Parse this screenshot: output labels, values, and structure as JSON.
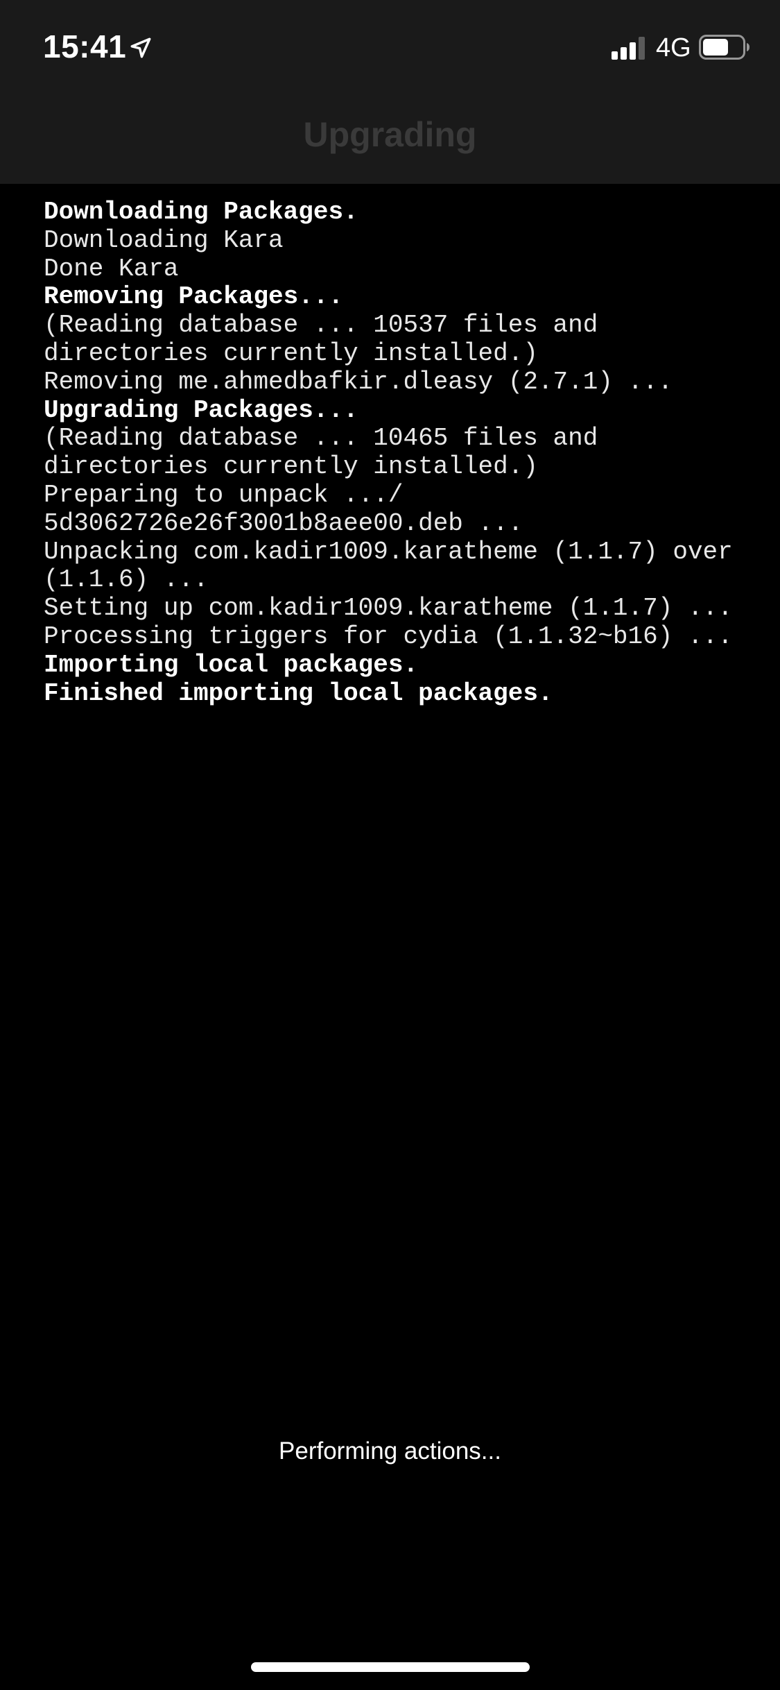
{
  "status_bar": {
    "time": "15:41",
    "network": "4G",
    "icons": [
      "location-arrow-icon",
      "cellular-signal-icon",
      "battery-icon"
    ]
  },
  "nav": {
    "title": "Upgrading"
  },
  "console": {
    "lines": [
      {
        "text": "Downloading Packages.",
        "bold": true
      },
      {
        "text": "Downloading Kara",
        "bold": false
      },
      {
        "text": "Done Kara",
        "bold": false
      },
      {
        "text": "Removing Packages...",
        "bold": true
      },
      {
        "text": "(Reading database ... 10537 files and",
        "bold": false
      },
      {
        "text": "directories currently installed.)",
        "bold": false
      },
      {
        "text": "Removing me.ahmedbafkir.dleasy (2.7.1) ...",
        "bold": false
      },
      {
        "text": "Upgrading Packages...",
        "bold": true
      },
      {
        "text": "(Reading database ... 10465 files and",
        "bold": false
      },
      {
        "text": "directories currently installed.)",
        "bold": false
      },
      {
        "text": "Preparing to unpack .../",
        "bold": false
      },
      {
        "text": "5d3062726e26f3001b8aee00.deb ...",
        "bold": false
      },
      {
        "text": "Unpacking com.kadir1009.karatheme (1.1.7) over",
        "bold": false
      },
      {
        "text": "(1.1.6) ...",
        "bold": false
      },
      {
        "text": "Setting up com.kadir1009.karatheme (1.1.7) ...",
        "bold": false
      },
      {
        "text": "Processing triggers for cydia (1.1.32~b16) ...",
        "bold": false
      },
      {
        "text": "Importing local packages.",
        "bold": true
      },
      {
        "text": "Finished importing local packages.",
        "bold": true
      }
    ]
  },
  "footer": {
    "status": "Performing actions..."
  },
  "colors": {
    "background": "#000000",
    "nav_background": "#1a1a1a",
    "nav_title": "#3a3a3a",
    "text": "#ffffff"
  }
}
